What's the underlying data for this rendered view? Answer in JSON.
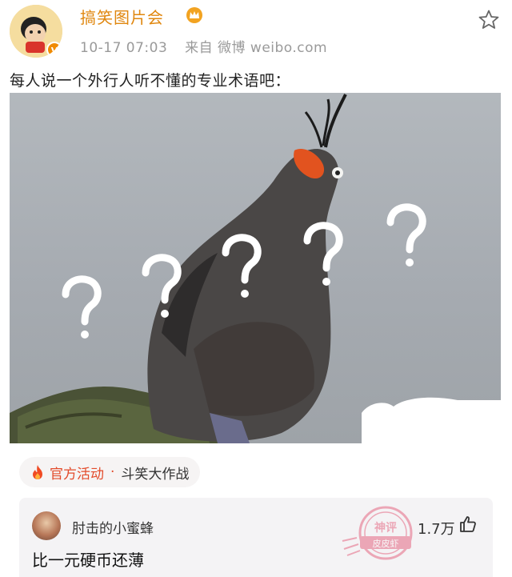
{
  "post": {
    "author": "搞笑图片会",
    "time": "10-17 07:03",
    "source": "来自 微博 weibo.com",
    "text": "每人说一个外行人听不懂的专业术语吧：",
    "avatar_badge": "V"
  },
  "image": {
    "icons": [
      "bird",
      "question-mark",
      "rock"
    ]
  },
  "topic": {
    "primary": "官方活动",
    "separator": "·",
    "secondary": "斗笑大作战"
  },
  "comment": {
    "username": "肘击的小蜜蜂",
    "text": "比一元硬币还薄",
    "likes": "1.7万",
    "stamp_line1": "神评",
    "stamp_line2": "皮皮虾"
  },
  "colors": {
    "author": "#e0870f",
    "topic_accent": "#e34b2b",
    "meta": "#9a9a9a"
  }
}
